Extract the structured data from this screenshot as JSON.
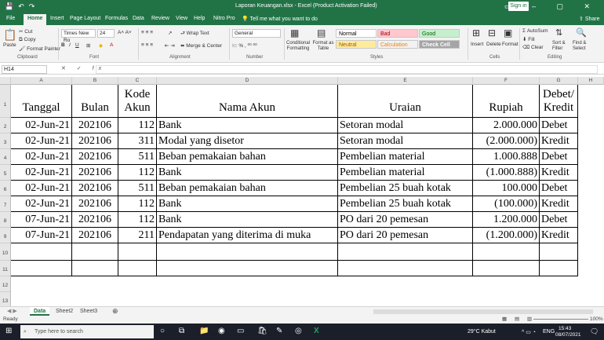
{
  "window": {
    "title": "Laporan Keuangan.xlsx  -  Excel (Product Activation Failed)",
    "signin": "Sign in",
    "share": "Share"
  },
  "tabs": [
    "File",
    "Home",
    "Insert",
    "Page Layout",
    "Formulas",
    "Data",
    "Review",
    "View",
    "Help",
    "Nitro Pro"
  ],
  "tell_me": "Tell me what you want to do",
  "ribbon": {
    "cut": "Cut",
    "copy": "Copy",
    "format_painter": "Format Painter",
    "paste": "Paste",
    "font_name": "Times New Ro",
    "font_size": "24",
    "wrap_text": "Wrap Text",
    "merge_center": "Merge & Center",
    "number_format": "General",
    "conditional_formatting": "Conditional Formatting",
    "format_as_table": "Format as Table",
    "styles": [
      {
        "label": "Normal",
        "bg": "#ffffff",
        "fg": "#000000"
      },
      {
        "label": "Bad",
        "bg": "#ffc7ce",
        "fg": "#9c0006"
      },
      {
        "label": "Good",
        "bg": "#c6efce",
        "fg": "#006100"
      },
      {
        "label": "Neutral",
        "bg": "#ffeb9c",
        "fg": "#9c5700"
      },
      {
        "label": "Calculation",
        "bg": "#f2f2f2",
        "fg": "#fa7d00"
      },
      {
        "label": "Check Cell",
        "bg": "#a5a5a5",
        "fg": "#ffffff"
      }
    ],
    "insert": "Insert",
    "delete": "Delete",
    "format": "Format",
    "autosum": "AutoSum",
    "fill": "Fill",
    "clear": "Clear",
    "sort_filter": "Sort & Filter",
    "find_select": "Find & Select",
    "groups": [
      "Clipboard",
      "Font",
      "Alignment",
      "Number",
      "Styles",
      "Cells",
      "Editing"
    ]
  },
  "formula_bar": {
    "name_box": "H14",
    "fx": "fx",
    "value": ""
  },
  "columns": [
    "A",
    "B",
    "C",
    "D",
    "E",
    "F",
    "G",
    "H"
  ],
  "rows": [
    "1",
    "2",
    "3",
    "4",
    "5",
    "6",
    "7",
    "8",
    "9",
    "10",
    "11",
    "12",
    "13"
  ],
  "table": {
    "headers": [
      "Tanggal",
      "Bulan",
      "Kode Akun",
      "Nama Akun",
      "Uraian",
      "Rupiah",
      "Debet/ Kredit"
    ],
    "data": [
      [
        "02-Jun-21",
        "202106",
        "112",
        "Bank",
        "Setoran modal",
        "2.000.000",
        "Debet"
      ],
      [
        "02-Jun-21",
        "202106",
        "311",
        "Modal yang disetor",
        "Setoran modal",
        "(2.000.000)",
        "Kredit"
      ],
      [
        "02-Jun-21",
        "202106",
        "511",
        "Beban pemakaian bahan",
        "Pembelian material",
        "1.000.888",
        "Debet"
      ],
      [
        "02-Jun-21",
        "202106",
        "112",
        "Bank",
        "Pembelian material",
        "(1.000.888)",
        "Kredit"
      ],
      [
        "02-Jun-21",
        "202106",
        "511",
        "Beban pemakaian bahan",
        "Pembelian 25 buah kotak",
        "100.000",
        "Debet"
      ],
      [
        "02-Jun-21",
        "202106",
        "112",
        "Bank",
        "Pembelian 25 buah kotak",
        "(100.000)",
        "Kredit"
      ],
      [
        "07-Jun-21",
        "202106",
        "112",
        "Bank",
        "PO dari 20 pemesan",
        "1.200.000",
        "Debet"
      ],
      [
        "07-Jun-21",
        "202106",
        "211",
        "Pendapatan yang diterima di muka",
        "PO dari 20 pemesan",
        "(1.200.000)",
        "Kredit"
      ]
    ]
  },
  "sheets": [
    "Data",
    "Sheet2",
    "Sheet3"
  ],
  "status": {
    "ready": "Ready",
    "zoom": "100%"
  },
  "taskbar": {
    "search_placeholder": "Type here to search",
    "weather": "29°C  Kabut",
    "lang": "ENG",
    "time": "15:43",
    "date": "08/07/2021"
  },
  "colors": {
    "excel_green": "#217346"
  }
}
